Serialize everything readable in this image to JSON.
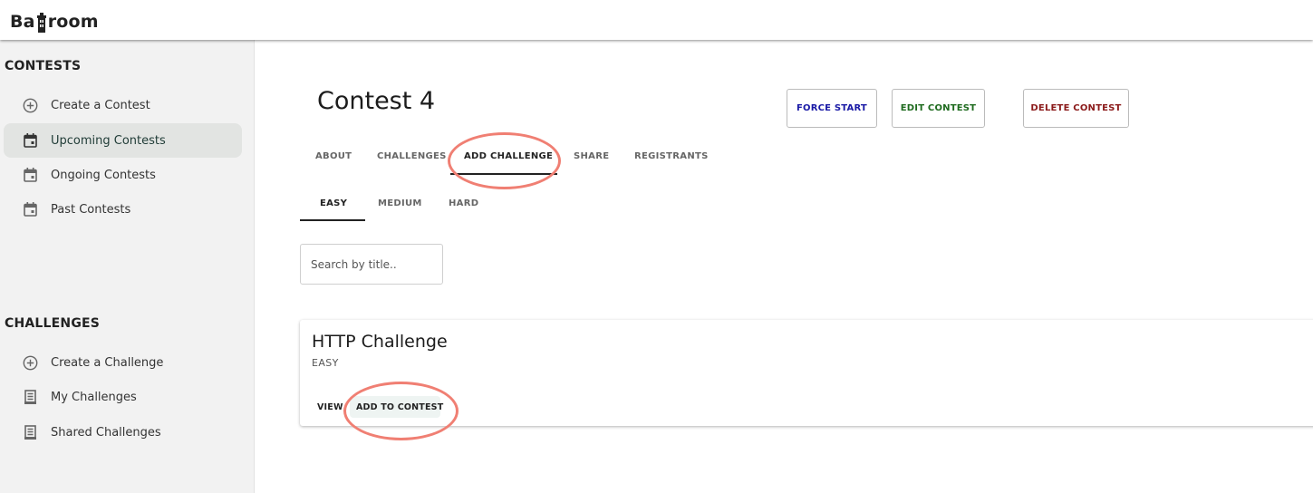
{
  "header": {
    "logo_left": "Ba",
    "logo_right": "room"
  },
  "sidebar": {
    "contests_title": "CONTESTS",
    "contest_items": [
      {
        "label": "Create a Contest",
        "icon": "add-circle-icon",
        "active": false
      },
      {
        "label": "Upcoming Contests",
        "icon": "calendar-icon",
        "active": true
      },
      {
        "label": "Ongoing Contests",
        "icon": "calendar-icon",
        "active": false
      },
      {
        "label": "Past Contests",
        "icon": "calendar-icon",
        "active": false
      }
    ],
    "challenges_title": "CHALLENGES",
    "challenge_items": [
      {
        "label": "Create a Challenge",
        "icon": "add-circle-icon",
        "active": false
      },
      {
        "label": "My Challenges",
        "icon": "document-icon",
        "active": false
      },
      {
        "label": "Shared Challenges",
        "icon": "document-icon",
        "active": false
      }
    ]
  },
  "main": {
    "title": "Contest 4",
    "buttons": {
      "force_start": "FORCE START",
      "edit_contest": "EDIT CONTEST",
      "delete_contest": "DELETE CONTEST"
    },
    "button_colors": {
      "force_start": "#1a1aa6",
      "edit_contest": "#1f6b1f",
      "delete_contest": "#8b1a1a"
    },
    "tabs": [
      "ABOUT",
      "CHALLENGES",
      "ADD CHALLENGE",
      "SHARE",
      "REGISTRANTS"
    ],
    "active_tab": "ADD CHALLENGE",
    "difficulty_tabs": [
      "EASY",
      "MEDIUM",
      "HARD"
    ],
    "active_difficulty": "EASY",
    "search": {
      "placeholder": "Search by title..",
      "value": ""
    },
    "card": {
      "title": "HTTP Challenge",
      "difficulty": "EASY",
      "view_label": "VIEW",
      "add_label": "ADD TO CONTEST"
    }
  },
  "annotation_color": "#f07f73"
}
